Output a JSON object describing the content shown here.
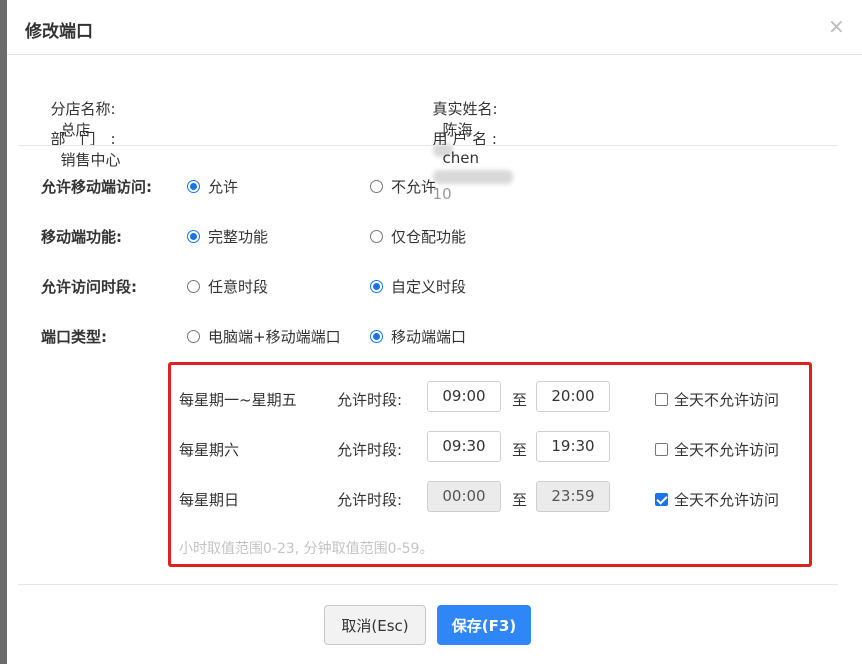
{
  "dialog": {
    "title": "修改端口",
    "close_glyph": "×"
  },
  "info": {
    "branch_label": "分店名称:",
    "branch_value": "总店",
    "realname_label": "真实姓名:",
    "realname_value": "陈海",
    "dept_label": "部　门　:",
    "dept_value": "销售中心",
    "username_label": "用 户 名 :",
    "username_value": "chen",
    "username_suffix": "10"
  },
  "settings": {
    "mobile_access": {
      "label": "允许移动端访问:",
      "options": [
        "允许",
        "不允许"
      ],
      "selected": 0
    },
    "mobile_function": {
      "label": "移动端功能:",
      "options": [
        "完整功能",
        "仅仓配功能"
      ],
      "selected": 0
    },
    "access_period": {
      "label": "允许访问时段:",
      "options": [
        "任意时段",
        "自定义时段"
      ],
      "selected": 1
    },
    "port_type": {
      "label": "端口类型:",
      "options": [
        "电脑端+移动端端口",
        "移动端端口"
      ],
      "selected": 1
    }
  },
  "schedule": {
    "period_label": "允许时段:",
    "to_label": "至",
    "allday_label": "全天不允许访问",
    "rows": [
      {
        "day": "每星期一~星期五",
        "start": "09:00",
        "end": "20:00",
        "all_day_denied": false
      },
      {
        "day": "每星期六",
        "start": "09:30",
        "end": "19:30",
        "all_day_denied": false
      },
      {
        "day": "每星期日",
        "start": "00:00",
        "end": "23:59",
        "all_day_denied": true
      }
    ],
    "hint": "小时取值范围0-23, 分钟取值范围0-59。"
  },
  "buttons": {
    "cancel": "取消(Esc)",
    "save": "保存(F3)"
  },
  "colors": {
    "accent": "#2f86f6",
    "highlight_border": "#e02020"
  }
}
